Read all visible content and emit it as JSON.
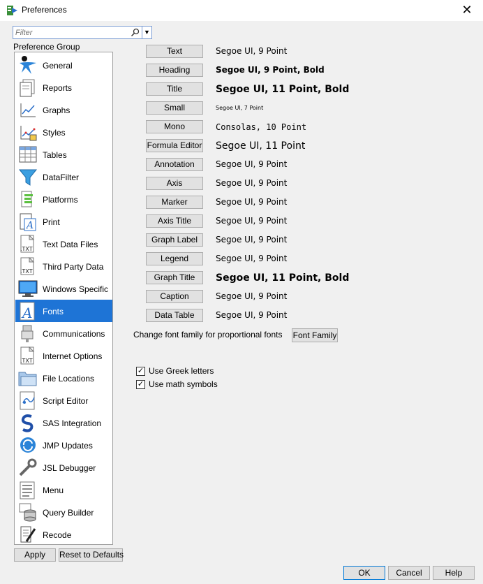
{
  "window": {
    "title": "Preferences",
    "close_glyph": "✕"
  },
  "filter": {
    "placeholder": "Filter",
    "dropdown_glyph": "▼"
  },
  "group_label": "Preference Group",
  "groups": [
    {
      "label": "General",
      "icon": "general-icon"
    },
    {
      "label": "Reports",
      "icon": "reports-icon"
    },
    {
      "label": "Graphs",
      "icon": "graphs-icon"
    },
    {
      "label": "Styles",
      "icon": "styles-icon"
    },
    {
      "label": "Tables",
      "icon": "tables-icon"
    },
    {
      "label": "DataFilter",
      "icon": "datafilter-icon"
    },
    {
      "label": "Platforms",
      "icon": "platforms-icon"
    },
    {
      "label": "Print",
      "icon": "print-icon"
    },
    {
      "label": "Text Data Files",
      "icon": "text-data-files-icon",
      "icon_text": ".TXT"
    },
    {
      "label": "Third Party Data",
      "icon": "third-party-data-icon",
      "icon_text": ".TXT"
    },
    {
      "label": "Windows Specific",
      "icon": "windows-specific-icon"
    },
    {
      "label": "Fonts",
      "icon": "fonts-icon",
      "selected": true
    },
    {
      "label": "Communications",
      "icon": "communications-icon"
    },
    {
      "label": "Internet Options",
      "icon": "internet-options-icon",
      "icon_text": ".TXT"
    },
    {
      "label": "File Locations",
      "icon": "file-locations-icon"
    },
    {
      "label": "Script Editor",
      "icon": "script-editor-icon"
    },
    {
      "label": "SAS Integration",
      "icon": "sas-integration-icon"
    },
    {
      "label": "JMP Updates",
      "icon": "jmp-updates-icon"
    },
    {
      "label": "JSL Debugger",
      "icon": "jsl-debugger-icon"
    },
    {
      "label": "Menu",
      "icon": "menu-icon"
    },
    {
      "label": "Query Builder",
      "icon": "query-builder-icon"
    },
    {
      "label": "Recode",
      "icon": "recode-icon"
    }
  ],
  "fonts": [
    {
      "button": "Text",
      "desc": "Segoe UI, 9 Point",
      "style": "sz9"
    },
    {
      "button": "Heading",
      "desc": "Segoe UI, 9 Point, Bold",
      "style": "sz9b"
    },
    {
      "button": "Title",
      "desc": "Segoe UI, 11 Point, Bold",
      "style": "sz11b"
    },
    {
      "button": "Small",
      "desc": "Segoe UI, 7 Point",
      "style": "sz7"
    },
    {
      "button": "Mono",
      "desc": "Consolas, 10 Point",
      "style": "mono"
    },
    {
      "button": "Formula Editor",
      "desc": "Segoe UI, 11 Point",
      "style": "sz11"
    },
    {
      "button": "Annotation",
      "desc": "Segoe UI, 9 Point",
      "style": "sz9"
    },
    {
      "button": "Axis",
      "desc": "Segoe UI, 9 Point",
      "style": "sz9"
    },
    {
      "button": "Marker",
      "desc": "Segoe UI, 9 Point",
      "style": "sz9"
    },
    {
      "button": "Axis Title",
      "desc": "Segoe UI, 9 Point",
      "style": "sz9"
    },
    {
      "button": "Graph Label",
      "desc": "Segoe UI, 9 Point",
      "style": "sz9"
    },
    {
      "button": "Legend",
      "desc": "Segoe UI, 9 Point",
      "style": "sz9"
    },
    {
      "button": "Graph Title",
      "desc": "Segoe UI, 11 Point, Bold",
      "style": "sz11b"
    },
    {
      "button": "Caption",
      "desc": "Segoe UI, 9 Point",
      "style": "sz9"
    },
    {
      "button": "Data Table",
      "desc": "Segoe UI, 9 Point",
      "style": "sz9"
    }
  ],
  "font_family": {
    "label": "Change font family for proportional fonts",
    "button": "Font Family"
  },
  "options": [
    {
      "label": "Use Greek letters",
      "checked": true
    },
    {
      "label": "Use math symbols",
      "checked": true
    }
  ],
  "check_glyph": "✓",
  "buttons": {
    "apply": "Apply",
    "reset": "Reset to Defaults",
    "ok": "OK",
    "cancel": "Cancel",
    "help": "Help"
  },
  "colors": {
    "selection": "#1e74d6",
    "focus_border": "#7a9cd3"
  }
}
